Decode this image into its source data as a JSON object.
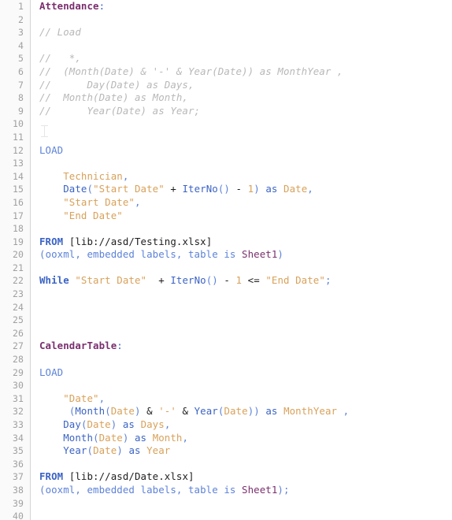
{
  "editor": {
    "name": "qlik-data-load-editor-script",
    "font_size_px": 12.4,
    "line_height_px": 16.6,
    "background_color": "#ffffff",
    "gutter_background_color": "#fafafa",
    "gutter_border_color": "#d4d4d4",
    "line_number_color": "#a0a0a0",
    "colors": {
      "table_label": "#7a2f6e",
      "keyword": "#3b63c4",
      "keyword_soft": "#5d82d8",
      "comment": "#b8b8b8",
      "string": "#d8a15a",
      "plain": "#1d1d1d"
    },
    "cursor": {
      "type": "i-beam-text-cursor",
      "line": 10,
      "visible": true
    }
  },
  "lines": [
    {
      "n": "1",
      "tokens": [
        {
          "t": "Attendance",
          "c": "tok-label"
        },
        {
          "t": ":",
          "c": "tok-colon"
        }
      ]
    },
    {
      "n": "2",
      "tokens": []
    },
    {
      "n": "3",
      "tokens": [
        {
          "t": "// Load",
          "c": "tok-comment"
        }
      ]
    },
    {
      "n": "4",
      "tokens": []
    },
    {
      "n": "5",
      "tokens": [
        {
          "t": "//   *,",
          "c": "tok-comment"
        }
      ]
    },
    {
      "n": "6",
      "tokens": [
        {
          "t": "//  (Month(Date) & '-' & Year(Date)) as MonthYear ,",
          "c": "tok-comment"
        }
      ]
    },
    {
      "n": "7",
      "tokens": [
        {
          "t": "//      Day(Date) as Days,",
          "c": "tok-comment"
        }
      ]
    },
    {
      "n": "8",
      "tokens": [
        {
          "t": "//  Month(Date) as Month,",
          "c": "tok-comment"
        }
      ]
    },
    {
      "n": "9",
      "tokens": [
        {
          "t": "//      Year(Date) as Year;",
          "c": "tok-comment"
        }
      ]
    },
    {
      "n": "10",
      "tokens": []
    },
    {
      "n": "11",
      "tokens": []
    },
    {
      "n": "12",
      "tokens": [
        {
          "t": "LOAD",
          "c": "tok-kw2"
        }
      ]
    },
    {
      "n": "13",
      "tokens": []
    },
    {
      "n": "14",
      "tokens": [
        {
          "t": "    ",
          "c": "tok-plain"
        },
        {
          "t": "Technician",
          "c": "tok-field"
        },
        {
          "t": ",",
          "c": "tok-punct"
        }
      ]
    },
    {
      "n": "15",
      "tokens": [
        {
          "t": "    ",
          "c": "tok-plain"
        },
        {
          "t": "Date",
          "c": "tok-func"
        },
        {
          "t": "(",
          "c": "tok-punct"
        },
        {
          "t": "\"Start Date\"",
          "c": "tok-string"
        },
        {
          "t": " ",
          "c": "tok-plain"
        },
        {
          "t": "+",
          "c": "tok-op"
        },
        {
          "t": " ",
          "c": "tok-plain"
        },
        {
          "t": "IterNo",
          "c": "tok-func"
        },
        {
          "t": "()",
          "c": "tok-punct"
        },
        {
          "t": " ",
          "c": "tok-plain"
        },
        {
          "t": "-",
          "c": "tok-op"
        },
        {
          "t": " ",
          "c": "tok-plain"
        },
        {
          "t": "1",
          "c": "tok-num"
        },
        {
          "t": ")",
          "c": "tok-punct"
        },
        {
          "t": " ",
          "c": "tok-plain"
        },
        {
          "t": "as",
          "c": "tok-as"
        },
        {
          "t": " ",
          "c": "tok-plain"
        },
        {
          "t": "Date",
          "c": "tok-field"
        },
        {
          "t": ",",
          "c": "tok-punct"
        }
      ]
    },
    {
      "n": "16",
      "tokens": [
        {
          "t": "    ",
          "c": "tok-plain"
        },
        {
          "t": "\"Start Date\"",
          "c": "tok-string"
        },
        {
          "t": ",",
          "c": "tok-punct"
        }
      ]
    },
    {
      "n": "17",
      "tokens": [
        {
          "t": "    ",
          "c": "tok-plain"
        },
        {
          "t": "\"End Date\"",
          "c": "tok-string"
        }
      ]
    },
    {
      "n": "18",
      "tokens": []
    },
    {
      "n": "19",
      "tokens": [
        {
          "t": "FROM",
          "c": "tok-kw"
        },
        {
          "t": " ",
          "c": "tok-plain"
        },
        {
          "t": "[lib://asd/Testing.xlsx]",
          "c": "tok-plain"
        }
      ]
    },
    {
      "n": "20",
      "tokens": [
        {
          "t": "(",
          "c": "tok-punct"
        },
        {
          "t": "ooxml, embedded labels, table is ",
          "c": "tok-kw2"
        },
        {
          "t": "Sheet1",
          "c": "tok-sheet"
        },
        {
          "t": ")",
          "c": "tok-punct"
        }
      ]
    },
    {
      "n": "21",
      "tokens": []
    },
    {
      "n": "22",
      "tokens": [
        {
          "t": "While",
          "c": "tok-kw"
        },
        {
          "t": " ",
          "c": "tok-plain"
        },
        {
          "t": "\"Start Date\"",
          "c": "tok-string"
        },
        {
          "t": "  ",
          "c": "tok-plain"
        },
        {
          "t": "+",
          "c": "tok-op"
        },
        {
          "t": " ",
          "c": "tok-plain"
        },
        {
          "t": "IterNo",
          "c": "tok-func"
        },
        {
          "t": "()",
          "c": "tok-punct"
        },
        {
          "t": " ",
          "c": "tok-plain"
        },
        {
          "t": "-",
          "c": "tok-op"
        },
        {
          "t": " ",
          "c": "tok-plain"
        },
        {
          "t": "1",
          "c": "tok-num"
        },
        {
          "t": " ",
          "c": "tok-plain"
        },
        {
          "t": "<=",
          "c": "tok-op"
        },
        {
          "t": " ",
          "c": "tok-plain"
        },
        {
          "t": "\"End Date\"",
          "c": "tok-string"
        },
        {
          "t": ";",
          "c": "tok-punct"
        }
      ]
    },
    {
      "n": "23",
      "tokens": []
    },
    {
      "n": "24",
      "tokens": []
    },
    {
      "n": "25",
      "tokens": []
    },
    {
      "n": "26",
      "tokens": []
    },
    {
      "n": "27",
      "tokens": [
        {
          "t": "CalendarTable",
          "c": "tok-label"
        },
        {
          "t": ":",
          "c": "tok-colon"
        }
      ]
    },
    {
      "n": "28",
      "tokens": []
    },
    {
      "n": "29",
      "tokens": [
        {
          "t": "LOAD",
          "c": "tok-kw2"
        }
      ]
    },
    {
      "n": "30",
      "tokens": []
    },
    {
      "n": "31",
      "tokens": [
        {
          "t": "    ",
          "c": "tok-plain"
        },
        {
          "t": "\"Date\"",
          "c": "tok-string"
        },
        {
          "t": ",",
          "c": "tok-punct"
        }
      ]
    },
    {
      "n": "32",
      "tokens": [
        {
          "t": "     ",
          "c": "tok-plain"
        },
        {
          "t": "(",
          "c": "tok-punct"
        },
        {
          "t": "Month",
          "c": "tok-func"
        },
        {
          "t": "(",
          "c": "tok-punct"
        },
        {
          "t": "Date",
          "c": "tok-field"
        },
        {
          "t": ")",
          "c": "tok-punct"
        },
        {
          "t": " ",
          "c": "tok-plain"
        },
        {
          "t": "&",
          "c": "tok-op"
        },
        {
          "t": " ",
          "c": "tok-plain"
        },
        {
          "t": "'-'",
          "c": "tok-string"
        },
        {
          "t": " ",
          "c": "tok-plain"
        },
        {
          "t": "&",
          "c": "tok-op"
        },
        {
          "t": " ",
          "c": "tok-plain"
        },
        {
          "t": "Year",
          "c": "tok-func"
        },
        {
          "t": "(",
          "c": "tok-punct"
        },
        {
          "t": "Date",
          "c": "tok-field"
        },
        {
          "t": "))",
          "c": "tok-punct"
        },
        {
          "t": " ",
          "c": "tok-plain"
        },
        {
          "t": "as",
          "c": "tok-as"
        },
        {
          "t": " ",
          "c": "tok-plain"
        },
        {
          "t": "MonthYear",
          "c": "tok-field"
        },
        {
          "t": " ",
          "c": "tok-plain"
        },
        {
          "t": ",",
          "c": "tok-punct"
        }
      ]
    },
    {
      "n": "33",
      "tokens": [
        {
          "t": "    ",
          "c": "tok-plain"
        },
        {
          "t": "Day",
          "c": "tok-func"
        },
        {
          "t": "(",
          "c": "tok-punct"
        },
        {
          "t": "Date",
          "c": "tok-field"
        },
        {
          "t": ")",
          "c": "tok-punct"
        },
        {
          "t": " ",
          "c": "tok-plain"
        },
        {
          "t": "as",
          "c": "tok-as"
        },
        {
          "t": " ",
          "c": "tok-plain"
        },
        {
          "t": "Days",
          "c": "tok-field"
        },
        {
          "t": ",",
          "c": "tok-punct"
        }
      ]
    },
    {
      "n": "34",
      "tokens": [
        {
          "t": "    ",
          "c": "tok-plain"
        },
        {
          "t": "Month",
          "c": "tok-func"
        },
        {
          "t": "(",
          "c": "tok-punct"
        },
        {
          "t": "Date",
          "c": "tok-field"
        },
        {
          "t": ")",
          "c": "tok-punct"
        },
        {
          "t": " ",
          "c": "tok-plain"
        },
        {
          "t": "as",
          "c": "tok-as"
        },
        {
          "t": " ",
          "c": "tok-plain"
        },
        {
          "t": "Month",
          "c": "tok-field"
        },
        {
          "t": ",",
          "c": "tok-punct"
        }
      ]
    },
    {
      "n": "35",
      "tokens": [
        {
          "t": "    ",
          "c": "tok-plain"
        },
        {
          "t": "Year",
          "c": "tok-func"
        },
        {
          "t": "(",
          "c": "tok-punct"
        },
        {
          "t": "Date",
          "c": "tok-field"
        },
        {
          "t": ")",
          "c": "tok-punct"
        },
        {
          "t": " ",
          "c": "tok-plain"
        },
        {
          "t": "as",
          "c": "tok-as"
        },
        {
          "t": " ",
          "c": "tok-plain"
        },
        {
          "t": "Year",
          "c": "tok-field"
        }
      ]
    },
    {
      "n": "36",
      "tokens": []
    },
    {
      "n": "37",
      "tokens": [
        {
          "t": "FROM",
          "c": "tok-kw"
        },
        {
          "t": " ",
          "c": "tok-plain"
        },
        {
          "t": "[lib://asd/Date.xlsx]",
          "c": "tok-plain"
        }
      ]
    },
    {
      "n": "38",
      "tokens": [
        {
          "t": "(",
          "c": "tok-punct"
        },
        {
          "t": "ooxml, embedded labels, table is ",
          "c": "tok-kw2"
        },
        {
          "t": "Sheet1",
          "c": "tok-sheet"
        },
        {
          "t": ");",
          "c": "tok-punct"
        }
      ]
    },
    {
      "n": "39",
      "tokens": []
    },
    {
      "n": "40",
      "tokens": []
    }
  ]
}
